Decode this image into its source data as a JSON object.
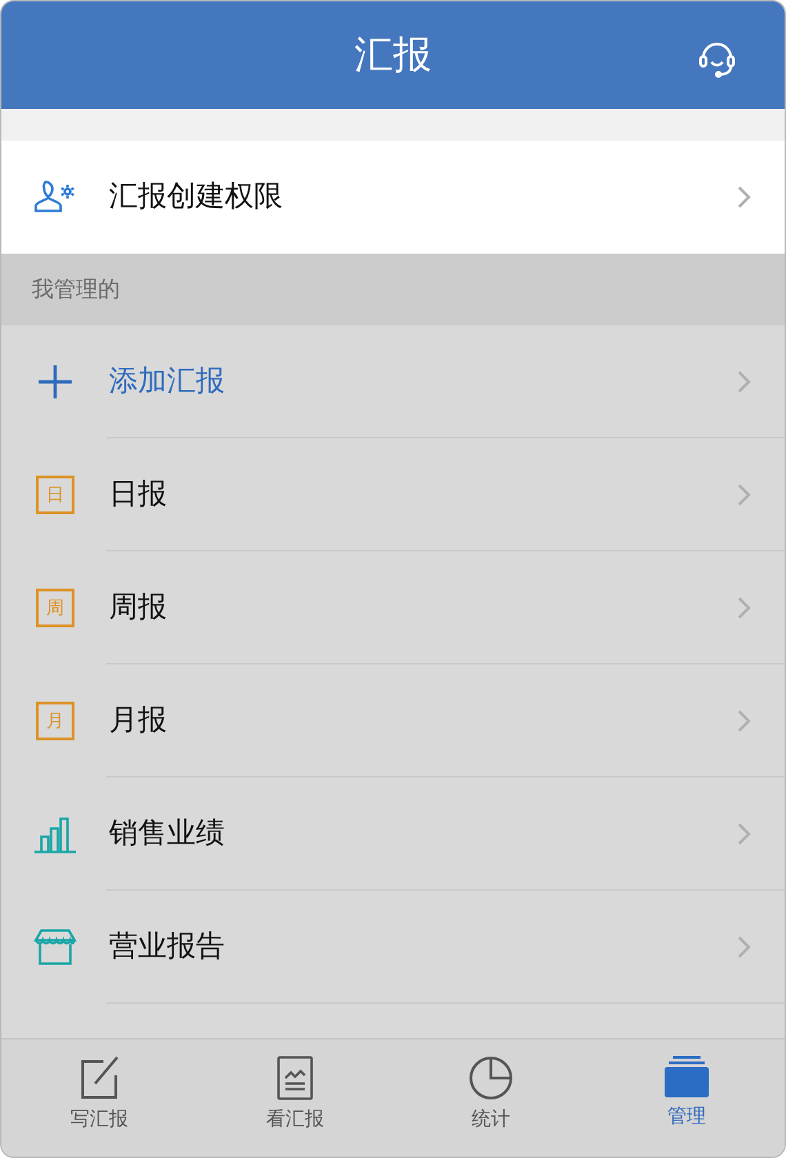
{
  "header": {
    "title": "汇报"
  },
  "permission_row": {
    "label": "汇报创建权限"
  },
  "section": {
    "title": "我管理的"
  },
  "items": [
    {
      "kind": "add",
      "label": "添加汇报"
    },
    {
      "kind": "calendar",
      "glyph": "日",
      "label": "日报"
    },
    {
      "kind": "calendar",
      "glyph": "周",
      "label": "周报"
    },
    {
      "kind": "calendar",
      "glyph": "月",
      "label": "月报"
    },
    {
      "kind": "chart",
      "label": "销售业绩"
    },
    {
      "kind": "store",
      "label": "营业报告"
    }
  ],
  "tabs": [
    {
      "kind": "write",
      "label": "写汇报",
      "selected": false
    },
    {
      "kind": "view",
      "label": "看汇报",
      "selected": false
    },
    {
      "kind": "stats",
      "label": "统计",
      "selected": false
    },
    {
      "kind": "manage",
      "label": "管理",
      "selected": true
    }
  ]
}
